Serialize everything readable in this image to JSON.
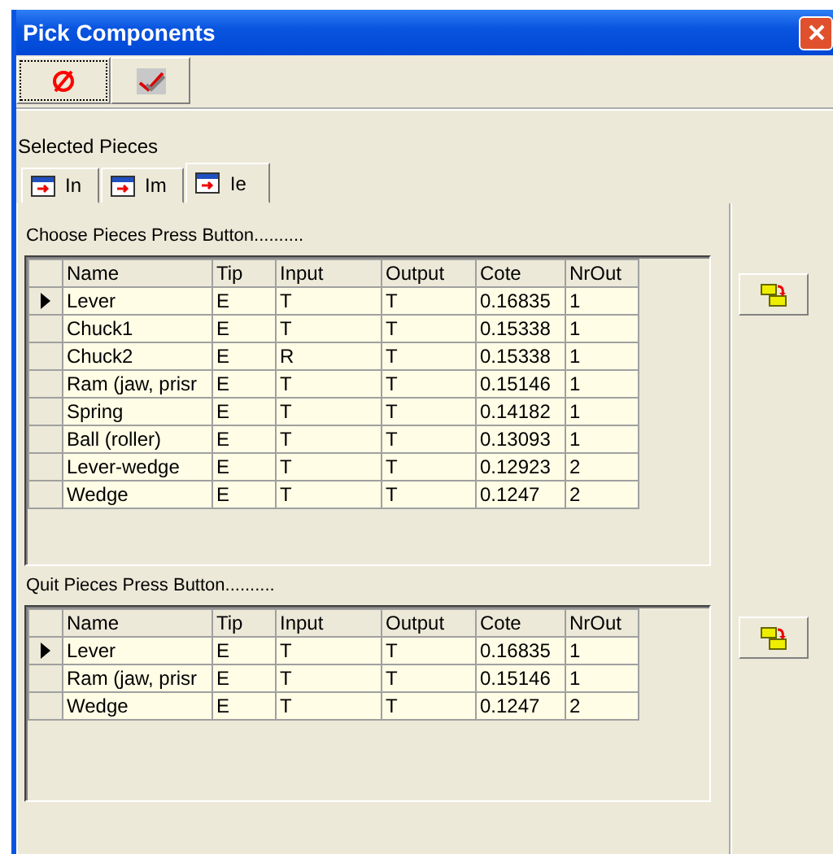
{
  "window": {
    "title": "Pick Components"
  },
  "toolbar": [
    {
      "kind": "cancel",
      "focused": true
    },
    {
      "kind": "accept",
      "focused": false
    }
  ],
  "section_label": "Selected Pieces",
  "tabs": [
    {
      "label": "In",
      "selected": false
    },
    {
      "label": "Im",
      "selected": false
    },
    {
      "label": "Ie",
      "selected": true
    }
  ],
  "grids": [
    {
      "label": "Choose Pieces Press Button..........",
      "columns": [
        "Name",
        "Tip",
        "Input",
        "Output",
        "Cote",
        "NrOut"
      ],
      "rows": [
        {
          "cells": [
            "Lever",
            "E",
            "T",
            "T",
            "0.16835",
            "1"
          ],
          "selected": true
        },
        {
          "cells": [
            "Chuck1",
            "E",
            "T",
            "T",
            "0.15338",
            "1"
          ],
          "selected": false
        },
        {
          "cells": [
            "Chuck2",
            "E",
            "R",
            "T",
            "0.15338",
            "1"
          ],
          "selected": false
        },
        {
          "cells": [
            "Ram (jaw, prisr",
            "E",
            "T",
            "T",
            "0.15146",
            "1"
          ],
          "selected": false
        },
        {
          "cells": [
            "Spring",
            "E",
            "T",
            "T",
            "0.14182",
            "1"
          ],
          "selected": false
        },
        {
          "cells": [
            "Ball (roller)",
            "E",
            "T",
            "T",
            "0.13093",
            "1"
          ],
          "selected": false
        },
        {
          "cells": [
            "Lever-wedge",
            "E",
            "T",
            "T",
            "0.12923",
            "2"
          ],
          "selected": false
        },
        {
          "cells": [
            "Wedge",
            "E",
            "T",
            "T",
            "0.1247",
            "2"
          ],
          "selected": false
        }
      ]
    },
    {
      "label": "Quit Pieces Press Button..........",
      "columns": [
        "Name",
        "Tip",
        "Input",
        "Output",
        "Cote",
        "NrOut"
      ],
      "rows": [
        {
          "cells": [
            "Lever",
            "E",
            "T",
            "T",
            "0.16835",
            "1"
          ],
          "selected": true
        },
        {
          "cells": [
            "Ram (jaw, prisr",
            "E",
            "T",
            "T",
            "0.15146",
            "1"
          ],
          "selected": false
        },
        {
          "cells": [
            "Wedge",
            "E",
            "T",
            "T",
            "0.1247",
            "2"
          ],
          "selected": false
        }
      ]
    }
  ]
}
